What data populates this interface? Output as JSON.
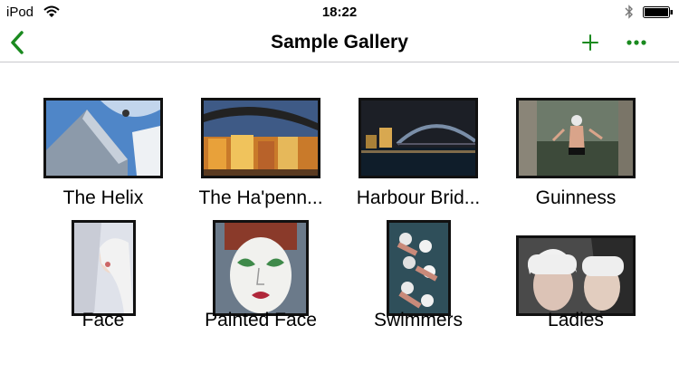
{
  "status_bar": {
    "carrier": "iPod",
    "time": "18:22"
  },
  "nav": {
    "title": "Sample Gallery",
    "back_icon": "chevron-left",
    "add_icon": "plus",
    "more_icon": "ellipsis"
  },
  "colors": {
    "accent": "#1a8a1f",
    "thumb_border": "#111111"
  },
  "gallery": {
    "items": [
      {
        "title": "The Helix"
      },
      {
        "title": "The Ha'penn..."
      },
      {
        "title": "Harbour Brid..."
      },
      {
        "title": "Guinness"
      },
      {
        "title": "Face"
      },
      {
        "title": "Painted Face"
      },
      {
        "title": "Swimmers"
      },
      {
        "title": "Ladies"
      }
    ]
  }
}
